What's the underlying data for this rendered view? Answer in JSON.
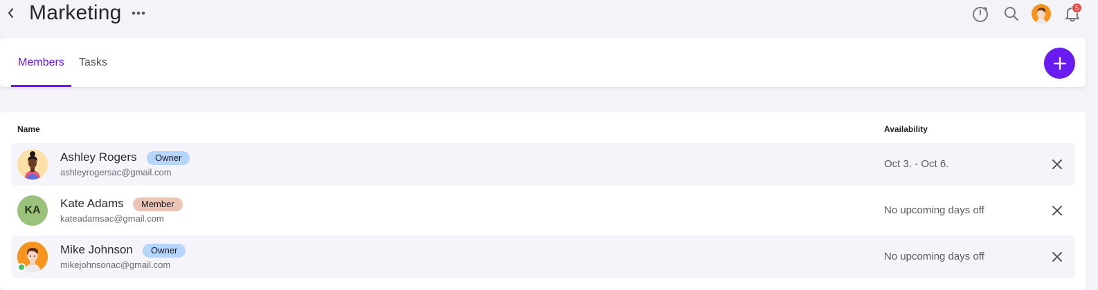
{
  "header": {
    "title": "Marketing",
    "notification_count": "5"
  },
  "tabs": [
    {
      "label": "Members",
      "active": true
    },
    {
      "label": "Tasks",
      "active": false
    }
  ],
  "table": {
    "columns": [
      "Name",
      "Availability"
    ],
    "rows": [
      {
        "name": "Ashley Rogers",
        "role": "Owner",
        "email": "ashleyrogersac@gmail.com",
        "availability": "Oct 3. - Oct 6.",
        "avatar": "illustrated-woman"
      },
      {
        "name": "Kate Adams",
        "role": "Member",
        "email": "kateadamsac@gmail.com",
        "availability": "No upcoming days off",
        "avatar": "initials",
        "initials": "KA"
      },
      {
        "name": "Mike Johnson",
        "role": "Owner",
        "email": "mikejohnsonac@gmail.com",
        "availability": "No upcoming days off",
        "avatar": "illustrated-man",
        "online": true
      }
    ]
  },
  "colors": {
    "accent": "#6a1bf0",
    "owner_pill": "#b6d5fb",
    "member_pill": "#ebc4b6",
    "online": "#41c75e",
    "badge": "#e54545"
  }
}
